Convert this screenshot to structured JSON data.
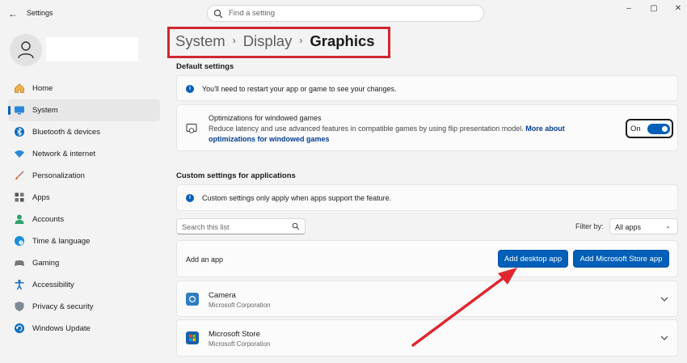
{
  "window": {
    "app_title": "Settings",
    "search_placeholder": "Find a setting",
    "controls": {
      "minimize": "–",
      "maximize": "▢",
      "close": "✕"
    }
  },
  "sidebar": {
    "items": [
      {
        "label": "Home",
        "icon": "home-icon",
        "active": false
      },
      {
        "label": "System",
        "icon": "system-icon",
        "active": true
      },
      {
        "label": "Bluetooth & devices",
        "icon": "bluetooth-icon",
        "active": false
      },
      {
        "label": "Network & internet",
        "icon": "wifi-icon",
        "active": false
      },
      {
        "label": "Personalization",
        "icon": "brush-icon",
        "active": false
      },
      {
        "label": "Apps",
        "icon": "apps-icon",
        "active": false
      },
      {
        "label": "Accounts",
        "icon": "account-icon",
        "active": false
      },
      {
        "label": "Time & language",
        "icon": "globe-clock-icon",
        "active": false
      },
      {
        "label": "Gaming",
        "icon": "gamepad-icon",
        "active": false
      },
      {
        "label": "Accessibility",
        "icon": "accessibility-icon",
        "active": false
      },
      {
        "label": "Privacy & security",
        "icon": "shield-icon",
        "active": false
      },
      {
        "label": "Windows Update",
        "icon": "update-icon",
        "active": false
      }
    ]
  },
  "breadcrumb": {
    "items": [
      "System",
      "Display",
      "Graphics"
    ],
    "separator": "›"
  },
  "default_settings": {
    "title": "Default settings",
    "restart_notice": "You'll need to restart your app or game to see your changes.",
    "windowed_games": {
      "title": "Optimizations for windowed games",
      "description": "Reduce latency and use advanced features in compatible games by using flip presentation model.",
      "link_part1": "More about",
      "link_part2": "optimizations for windowed games",
      "toggle_label": "On",
      "toggle_on": true
    }
  },
  "custom_settings": {
    "title": "Custom settings for applications",
    "notice": "Custom settings only apply when apps support the feature.",
    "search_placeholder": "Search this list",
    "filter_label": "Filter by:",
    "filter_value": "All apps",
    "add_app_label": "Add an app",
    "add_desktop_button": "Add desktop app",
    "add_store_button": "Add Microsoft Store app",
    "apps": [
      {
        "name": "Camera",
        "publisher": "Microsoft Corporation"
      },
      {
        "name": "Microsoft Store",
        "publisher": "Microsoft Corporation"
      }
    ]
  },
  "colors": {
    "accent": "#005fb8",
    "highlight_box": "#d0262e",
    "annotation_arrow": "#e0262e"
  }
}
